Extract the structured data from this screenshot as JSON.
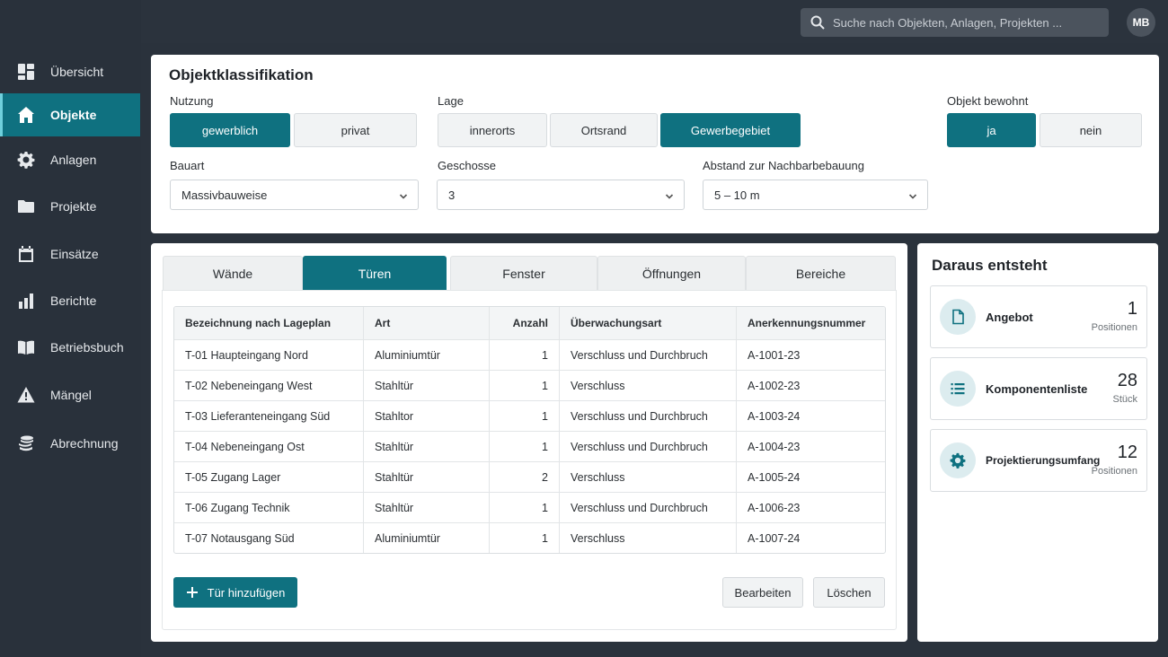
{
  "sidebar": {
    "items": [
      {
        "label": "Übersicht",
        "icon": "dashboard-icon"
      },
      {
        "label": "Objekte",
        "icon": "home-icon",
        "active": true
      },
      {
        "label": "Anlagen",
        "icon": "gear-icon"
      },
      {
        "label": "Projekte",
        "icon": "folder-icon"
      },
      {
        "label": "Einsätze",
        "icon": "calendar-icon"
      },
      {
        "label": "Berichte",
        "icon": "bar-chart-icon"
      },
      {
        "label": "Betriebsbuch",
        "icon": "book-icon"
      },
      {
        "label": "Mängel",
        "icon": "warning-icon"
      },
      {
        "label": "Abrechnung",
        "icon": "coins-icon"
      }
    ]
  },
  "header": {
    "search_placeholder": "Suche nach Objekten, Anlagen, Projekten ...",
    "avatar_initials": "MB"
  },
  "classification": {
    "title": "Objektklassifikation",
    "nutzung": {
      "label": "Nutzung",
      "options": [
        "gewerblich",
        "privat"
      ],
      "selected": "gewerblich"
    },
    "lage": {
      "label": "Lage",
      "options": [
        "innerorts",
        "Ortsrand",
        "Gewerbegebiet"
      ],
      "selected": "Gewerbegebiet"
    },
    "bewohnt": {
      "label": "Objekt bewohnt",
      "options": [
        "ja",
        "nein"
      ],
      "selected": "ja"
    },
    "bauart": {
      "label": "Bauart",
      "value": "Massivbauweise"
    },
    "geschosse": {
      "label": "Geschosse",
      "value": "3"
    },
    "abstand": {
      "label": "Abstand zur Nachbarbebauung",
      "value": "5 – 10 m"
    }
  },
  "tabs": {
    "items": [
      "Wände",
      "Türen",
      "Fenster",
      "Öffnungen",
      "Bereiche"
    ],
    "selected": "Türen"
  },
  "doors_table": {
    "headers": [
      "Bezeichnung nach Lageplan",
      "Art",
      "Anzahl",
      "Überwachungsart",
      "Anerkennungsnummer"
    ],
    "rows": [
      [
        "T-01 Haupteingang Nord",
        "Aluminiumtür",
        "1",
        "Verschluss und Durchbruch",
        "A-1001-23"
      ],
      [
        "T-02 Nebeneingang West",
        "Stahltür",
        "1",
        "Verschluss",
        "A-1002-23"
      ],
      [
        "T-03 Lieferanteneingang Süd",
        "Stahltor",
        "1",
        "Verschluss und Durchbruch",
        "A-1003-24"
      ],
      [
        "T-04 Nebeneingang Ost",
        "Stahltür",
        "1",
        "Verschluss und Durchbruch",
        "A-1004-23"
      ],
      [
        "T-05 Zugang Lager",
        "Stahltür",
        "2",
        "Verschluss",
        "A-1005-24"
      ],
      [
        "T-06 Zugang Technik",
        "Stahltür",
        "1",
        "Verschluss und Durchbruch",
        "A-1006-23"
      ],
      [
        "T-07 Notausgang Süd",
        "Aluminiumtür",
        "1",
        "Verschluss",
        "A-1007-24"
      ]
    ]
  },
  "actions": {
    "add": "Tür hinzufügen",
    "edit": "Bearbeiten",
    "delete": "Löschen"
  },
  "result": {
    "title": "Daraus entsteht",
    "cards": [
      {
        "label": "Angebot",
        "value": "1",
        "unit": "Positionen",
        "icon": "document-icon"
      },
      {
        "label": "Komponentenliste",
        "value": "28",
        "unit": "Stück",
        "icon": "list-icon"
      },
      {
        "label": "Projektierungsumfang",
        "value": "12",
        "unit": "Positionen",
        "icon": "gear-icon"
      }
    ]
  },
  "colors": {
    "accent": "#0f7180",
    "sidebar": "#29313b",
    "background": "#2a323c"
  }
}
